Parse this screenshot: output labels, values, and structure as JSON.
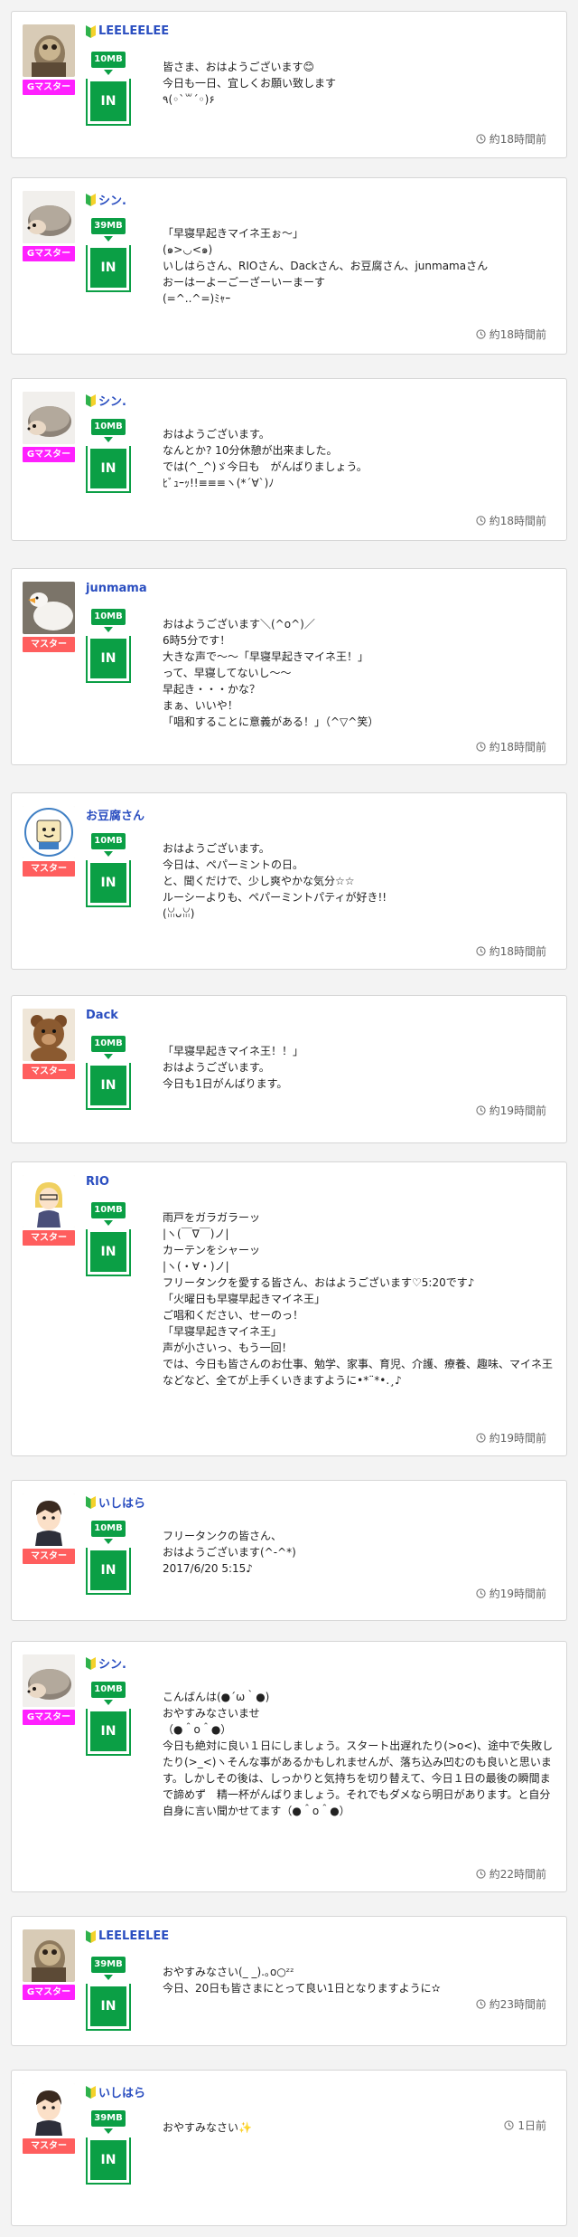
{
  "posts": [
    {
      "name": "LEELEELEE",
      "beginner": true,
      "rank": "Gマスター",
      "rank_type": "g",
      "size": "10MB",
      "in_label": "IN",
      "avatar": "fish-avatar",
      "text": "皆さま、おはようございます😊\n今日も一日、宜しくお願い致します\n٩(◦`꒳´◦)۶",
      "time": "約18時間前"
    },
    {
      "name": "シン.",
      "beginner": true,
      "rank": "Gマスター",
      "rank_type": "g",
      "size": "39MB",
      "in_label": "IN",
      "avatar": "hedgehog-avatar",
      "text": "「早寝早起きマイネ王ぉ〜」\n(๑>◡<๑)\nいしはらさん、RIOさん、Dackさん、お豆腐さん、junmamaさん\nおーはーよーごーざーいーまーす\n(=^..^=)ﾐｬｰ",
      "time": "約18時間前"
    },
    {
      "name": "シン.",
      "beginner": true,
      "rank": "Gマスター",
      "rank_type": "g",
      "size": "10MB",
      "in_label": "IN",
      "avatar": "hedgehog-avatar",
      "text": "おはようございます。\nなんとか? 10分休憩が出来ました。\nでは(^_^)ゞ今日も　がんばりましょう。\nﾋﾞｭｰｯ!!≡≡≡ヽ(*´∀`)ﾉ",
      "time": "約18時間前"
    },
    {
      "name": "junmama",
      "beginner": false,
      "rank": "マスター",
      "rank_type": "m",
      "size": "10MB",
      "in_label": "IN",
      "avatar": "swan-avatar",
      "text": "おはようございます＼(^o^)／\n6時5分です！\n大きな声で〜〜「早寝早起きマイネ王！」\nって、早寝してないし〜〜\n早起き・・・かな？\nまぁ、いいや！\n「唱和することに意義がある！」（^▽^笑）",
      "time": "約18時間前"
    },
    {
      "name": "お豆腐さん",
      "beginner": false,
      "rank": "マスター",
      "rank_type": "m",
      "size": "10MB",
      "in_label": "IN",
      "avatar": "tofu-avatar",
      "text": "おはようございます。\n今日は、ペパーミントの日。\nと、聞くだけで、少し爽やかな気分☆☆\nルーシーよりも、ペパーミントパティが好き!!\n(ꈍᴗꈍ)",
      "time": "約18時間前"
    },
    {
      "name": "Dack",
      "beginner": false,
      "rank": "マスター",
      "rank_type": "m",
      "size": "10MB",
      "in_label": "IN",
      "avatar": "bear-avatar",
      "text": "「早寝早起きマイネ王！！」\nおはようございます。\n今日も1日がんばります。",
      "time": "約19時間前"
    },
    {
      "name": "RIO",
      "beginner": false,
      "rank": "マスター",
      "rank_type": "m",
      "size": "10MB",
      "in_label": "IN",
      "avatar": "blonde-avatar",
      "text": "雨戸をガラガラーッ\n|ヽ(￣∇￣)ノ|\nカーテンをシャーッ\n|ヽ(・∀・)ノ|\nフリータンクを愛する皆さん、おはようございます♡5:20です♪\n「火曜日も早寝早起きマイネ王」\nご唱和ください、せーのっ！\n「早寝早起きマイネ王」\n声が小さいっ、もう一回！\nでは、今日も皆さんのお仕事、勉学、家事、育児、介護、療養、趣味、マイネ王などなど、全てが上手くいきますように•*¨*•.¸♪",
      "time": "約19時間前"
    },
    {
      "name": "いしはら",
      "beginner": true,
      "rank": "マスター",
      "rank_type": "m",
      "size": "10MB",
      "in_label": "IN",
      "avatar": "boy-avatar",
      "text": "フリータンクの皆さん、\nおはようございます(^-^*)\n2017/6/20 5:15♪",
      "time": "約19時間前"
    },
    {
      "name": "シン.",
      "beginner": true,
      "rank": "Gマスター",
      "rank_type": "g",
      "size": "10MB",
      "in_label": "IN",
      "avatar": "hedgehog-avatar",
      "text": "こんばんは(●´ω｀●)\nおやすみなさいませ\n（●＾o＾●）\n今日も絶対に良い１日にしましょう。スタート出遅れたり(>o<)、途中で失敗したり(>_<)ヽそんな事があるかもしれませんが、落ち込み凹むのも良いと思います。しかしその後は、しっかりと気持ちを切り替えて、今日１日の最後の瞬間まで諦めず　精一杯がんばりましょう。それでもダメなら明日があります。と自分自身に言い聞かせてます（●＾o＾●）",
      "time": "約22時間前"
    },
    {
      "name": "LEELEELEE",
      "beginner": true,
      "rank": "Gマスター",
      "rank_type": "g",
      "size": "39MB",
      "in_label": "IN",
      "avatar": "fish-avatar",
      "text": "おやすみなさい(_ _).｡o○ᶻᶻ\n今日、20日も皆さまにとって良い1日となりますように✫",
      "time": "約23時間前"
    },
    {
      "name": "いしはら",
      "beginner": true,
      "rank": "マスター",
      "rank_type": "m",
      "size": "39MB",
      "in_label": "IN",
      "avatar": "boy-avatar",
      "text": "おやすみなさい✨",
      "time": "1日前"
    }
  ]
}
